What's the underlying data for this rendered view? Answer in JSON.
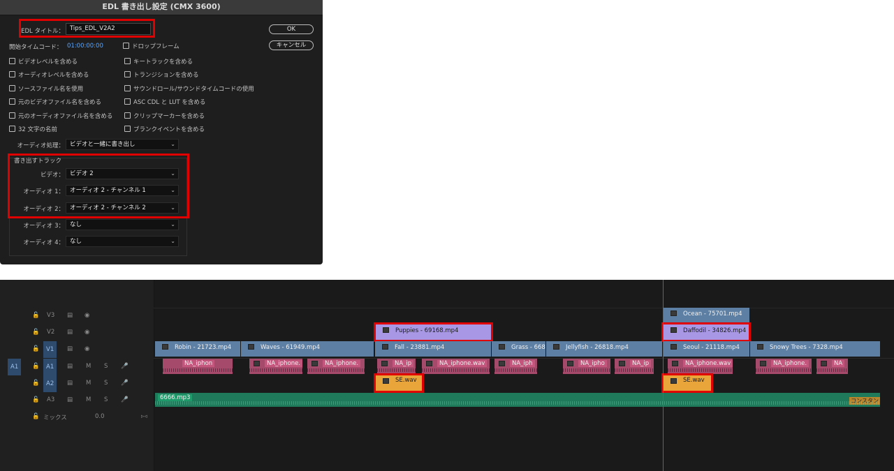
{
  "dialog": {
    "title": "EDL 書き出し設定 (CMX 3600)",
    "edl_title_label": "EDL タイトル：",
    "edl_title_value": "Tips_EDL_V2A2",
    "start_tc_label": "開始タイムコード：",
    "start_tc_value": "01:00:00:00",
    "ok_label": "OK",
    "cancel_label": "キャンセル",
    "checkboxes": {
      "drop_frame": "ドロップフレーム",
      "video_levels": "ビデオレベルを含める",
      "key_track": "キートラックを含める",
      "audio_levels": "オーディオレベルを含める",
      "transitions": "トランジションを含める",
      "source_file_name": "ソースファイル名を使用",
      "sound_roll": "サウンドロール/サウンドタイムコードの使用",
      "orig_video_name": "元のビデオファイル名を含める",
      "asc_cdl": "ASC CDL と LUT を含める",
      "orig_audio_name": "元のオーディオファイル名を含める",
      "clip_markers": "クリップマーカーを含める",
      "name_32": "32 文字の名前",
      "blank_events": "ブランクイベントを含める"
    },
    "audio_processing_label": "オーディオ処理：",
    "audio_processing_value": "ビデオと一緒に書き出し",
    "export_tracks_label": "書き出すトラック",
    "video_label": "ビデオ：",
    "video_value": "ビデオ 2",
    "audio1_label": "オーディオ 1：",
    "audio1_value": "オーディオ 2 - チャンネル 1",
    "audio2_label": "オーディオ 2：",
    "audio2_value": "オーディオ 2 - チャンネル 2",
    "audio3_label": "オーディオ 3：",
    "audio3_value": "なし",
    "audio4_label": "オーディオ 4：",
    "audio4_value": "なし"
  },
  "timeline": {
    "tracks": [
      {
        "label": "V3",
        "type": "video"
      },
      {
        "label": "V2",
        "type": "video"
      },
      {
        "label": "V1",
        "type": "video",
        "source": true
      },
      {
        "label": "A1",
        "type": "audio",
        "source": true,
        "source_patch": "A1"
      },
      {
        "label": "A2",
        "type": "audio",
        "source": true
      },
      {
        "label": "A3",
        "type": "audio"
      }
    ],
    "mix_label": "ミックス",
    "mix_value": "0.0",
    "m_label": "M",
    "s_label": "S",
    "clips": {
      "ocean": "Ocean - 75701.mp4",
      "puppies": "Puppies - 69168.mp4",
      "daffodil": "Daffodil - 34826.mp4",
      "robin": "Robin - 21723.mp4",
      "waves": "Waves - 61949.mp4",
      "fall": "Fall - 23881.mp4",
      "grass": "Grass - 668",
      "jellyfish": "Jellyfish - 26818.mp4",
      "seoul": "Seoul - 21118.mp4",
      "snowy": "Snowy Trees - 7328.mp4",
      "na1": "NA_iphon",
      "na2": "NA_iphone.",
      "na3": "NA_iphone.",
      "na4": "NA_ip",
      "na5": "NA_iphone.wav",
      "na6": "NA_iph",
      "na7": "NA_ipho",
      "na8": "NA_ip",
      "na9": "NA_iphone.wav",
      "na10": "NA_iphone.",
      "na11": "NA",
      "se1": "SE.wav",
      "se2": "SE.wav",
      "music": "6666.mp3",
      "constant": "コンスタン"
    }
  },
  "colors": {
    "highlight": "#e00000",
    "video_clip": "#5d7fa4",
    "selected_clip": "#a797e5",
    "audio_clip": "#a64a6c",
    "se_clip": "#e9a43a",
    "music_clip": "#1e7a5a"
  }
}
